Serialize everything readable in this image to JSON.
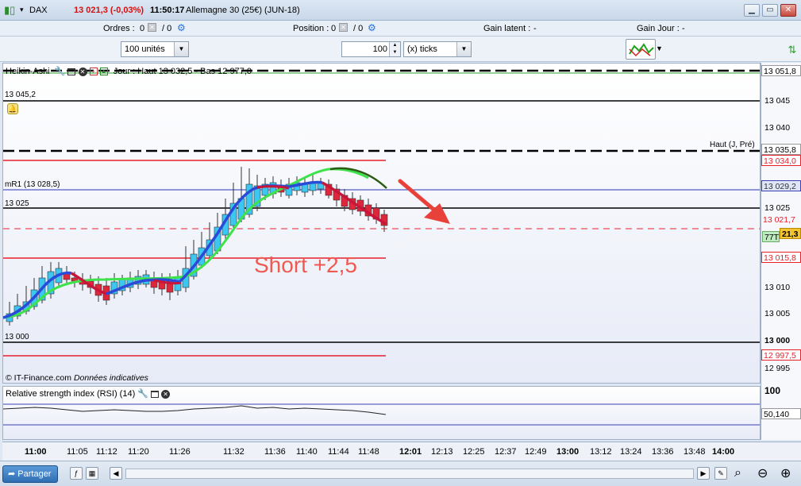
{
  "titlebar": {
    "symbol": "DAX",
    "price_change": "13 021,3 (-0,03%)",
    "time": "11:50:17",
    "instrument": "Allemagne 30 (25€) (JUN-18)",
    "minimize": "▁",
    "restore": "▭",
    "close": "✕"
  },
  "orders_bar": {
    "orders_label": "Ordres :",
    "orders_value": "0",
    "orders_sep": "/ 0",
    "position_label": "Position :",
    "position_value": "0",
    "position_sep": "/ 0",
    "gain_latent_label": "Gain latent :",
    "gain_latent_value": "-",
    "gain_jour_label": "Gain Jour :",
    "gain_jour_value": "-"
  },
  "toolbar": {
    "units_select": "100 unités",
    "ticks_value": "100",
    "ticks_select": "(x) ticks"
  },
  "chart": {
    "indicator_name": "Heikin-Ashi",
    "day_info": "Jour : Haut 13 032,5 - Bas 12 977,0",
    "left_labels": {
      "l1": "13 045,2",
      "l2": "mR1 (13 028,5)",
      "l3": "13 025",
      "l4": "13 000"
    },
    "annotation": "Short +2,5",
    "haut_label": "Haut (J, Pré)",
    "copyright": "© IT-Finance.com",
    "data_note": "Données indicatives",
    "price_ticks": [
      "13 051,8",
      "13 045",
      "13 040",
      "13 035,8",
      "13 034,0",
      "13 029,2",
      "13 025",
      "13 021,7",
      "21,3",
      "13 015,8",
      "13 010",
      "13 005",
      "13 000",
      "12 997,5",
      "12 995"
    ],
    "tag_77t": "77T",
    "colors": {
      "ha_up": "#3cc6f0",
      "ha_down": "#e0263a",
      "ma_fast_up": "#2a4ad8",
      "ma_fast_down": "#c8163a",
      "ma_slow": "#3ee24a",
      "ma_projection": "#2a5a14",
      "arrow": "#e8413a",
      "support_red": "#e8202c"
    }
  },
  "rsi": {
    "title": "Relative strength index (RSI) (14)",
    "tick_100": "100",
    "value": "50,140"
  },
  "time_axis": [
    "11:00",
    "11:05",
    "11:12",
    "11:20",
    "11:26",
    "11:32",
    "11:36",
    "11:40",
    "11:44",
    "11:48",
    "12:01",
    "12:13",
    "12:25",
    "12:37",
    "12:49",
    "13:00",
    "13:12",
    "13:24",
    "13:36",
    "13:48",
    "14:00"
  ],
  "bottom": {
    "partager": "Partager"
  }
}
